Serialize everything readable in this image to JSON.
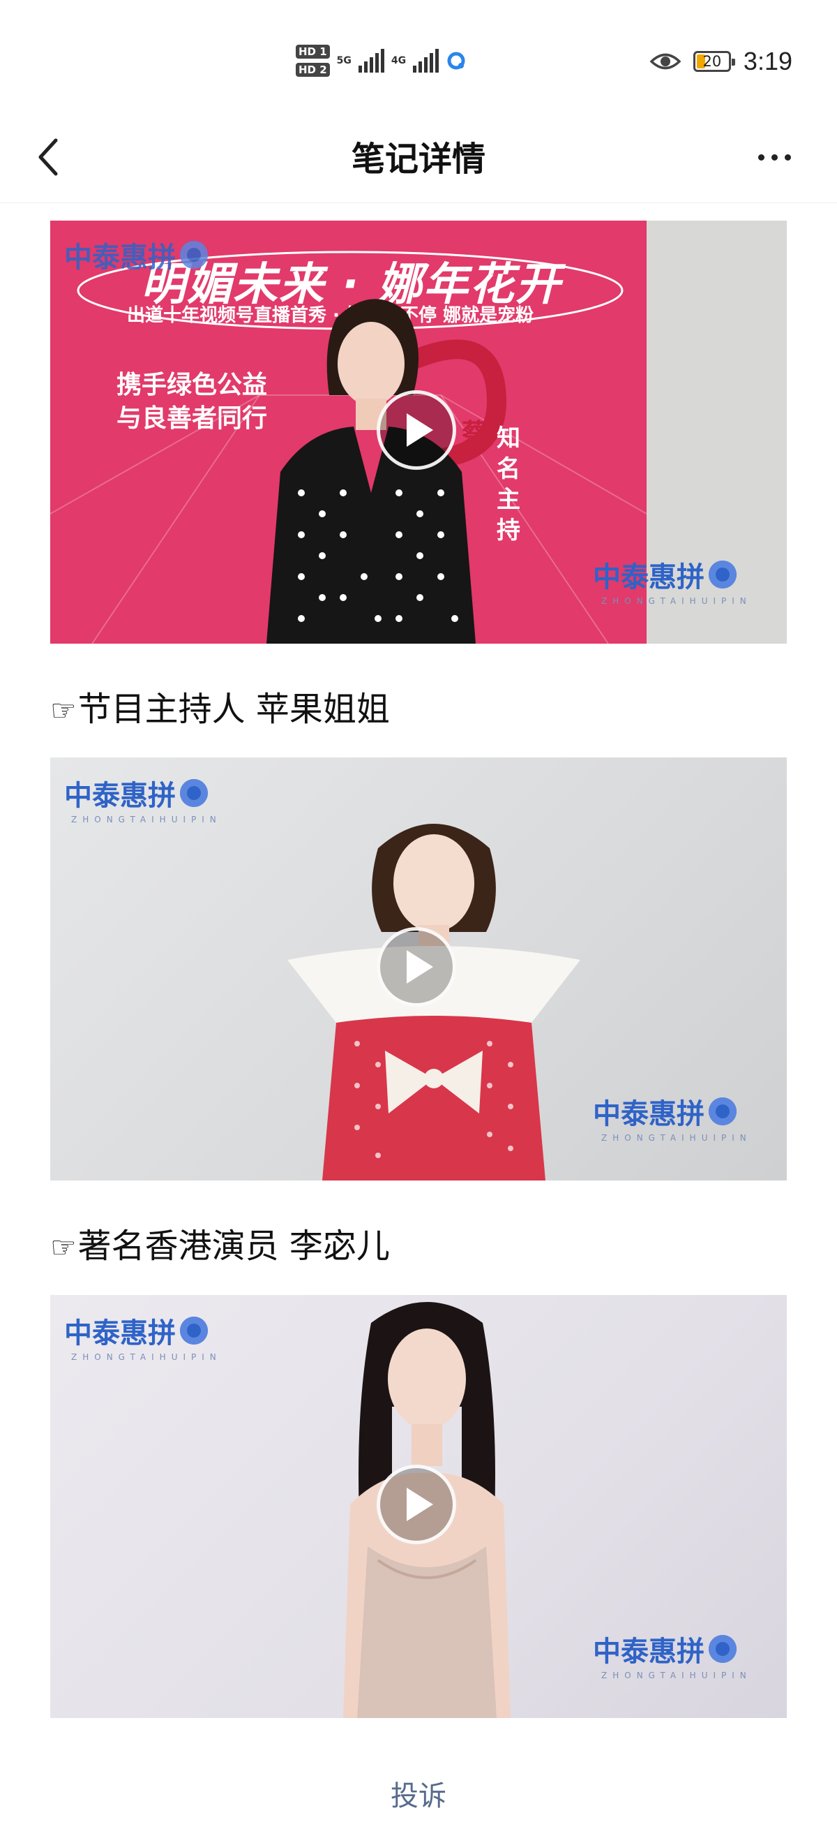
{
  "status_bar": {
    "sim1": "HD 1",
    "sim2": "HD 2",
    "net1": "5G",
    "net2": "4G",
    "battery": "20",
    "time": "3:19",
    "icons": [
      "eye-icon",
      "battery-icon",
      "signal-icon"
    ]
  },
  "nav": {
    "title": "笔记详情",
    "back_icon": "chevron-left-icon",
    "more_icon": "more-dots-icon"
  },
  "videos": [
    {
      "logo": "中泰惠拼",
      "logo_sub": "ZHONGTAIHUIPIN",
      "banner_title": "明媚未来 · 娜年花开",
      "banner_subtitle": "出道十年视频号直播首秀 · 好礼抽不停 娜就是宠粉",
      "side_text_1": "携手绿色公益",
      "side_text_2": "与良善者同行",
      "name_tag": "蔡",
      "vertical_text": "知名主持"
    },
    {
      "logo": "中泰惠拼",
      "logo_sub": "ZHONGTAIHUIPIN"
    },
    {
      "logo": "中泰惠拼",
      "logo_sub": "ZHONGTAIHUIPIN"
    }
  ],
  "captions": [
    {
      "hand": "☞",
      "text": "节目主持人 苹果姐姐"
    },
    {
      "hand": "☞",
      "text": "著名香港演员 李宓儿"
    }
  ],
  "footer": {
    "complaint": "投诉"
  },
  "colors": {
    "brand_blue": "#2f63c7",
    "banner_pink": "#e23a6a",
    "link_gray_blue": "#566b8c"
  }
}
